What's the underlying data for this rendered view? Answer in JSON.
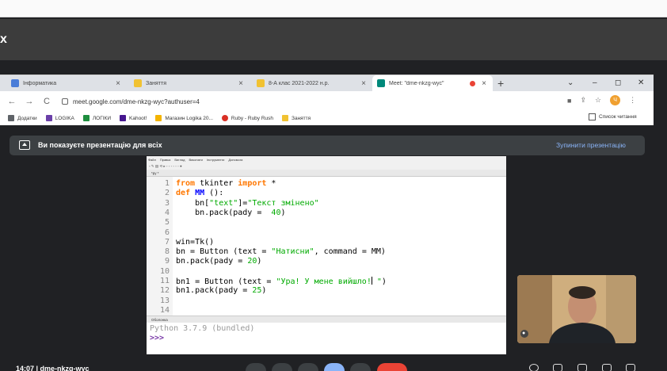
{
  "outer": {
    "close_label": "x"
  },
  "tabs": [
    {
      "title": "Інформатика",
      "color": "#4a7dd8"
    },
    {
      "title": "Заняття",
      "color": "#f1c232"
    },
    {
      "title": "8-А клас 2021-2022 н.р.",
      "color": "#f1c232"
    },
    {
      "title": "Meet: \"dme-nkzg-wyc\"",
      "color": "#00897b"
    }
  ],
  "new_tab": "+",
  "window_controls": [
    "⌄",
    "–",
    "◻",
    "✕"
  ],
  "address": {
    "url": "meet.google.com/dme-nkzg-wyc?authuser=4"
  },
  "nav": {
    "back": "←",
    "forward": "→",
    "reload": "C"
  },
  "profile_initial": "Ч",
  "bookmarks": [
    {
      "label": "Додатки",
      "color": "#5f6368"
    },
    {
      "label": "LOGIKA",
      "color": "#6a3fa8"
    },
    {
      "label": "ЛОГІКИ",
      "color": "#1e8e3e"
    },
    {
      "label": "Kahoot!",
      "color": "#46178f"
    },
    {
      "label": "Магазин Logika 20...",
      "color": "#f4b400"
    },
    {
      "label": "Ruby - Ruby Rush",
      "color": "#d93025"
    },
    {
      "label": "Заняття",
      "color": "#f1c232"
    }
  ],
  "reading_list": "Список читання",
  "banner": {
    "text": "Ви показуєте презентацію для всіх",
    "stop": "Зупинити презентацію"
  },
  "idle": {
    "menu": [
      "Файл",
      "Правка",
      "Вигляд",
      "Виконати",
      "Інструменти",
      "Допомога"
    ],
    "toolbar": "▫ ✎ ▤ ⟲ ▸ ◦ ◦ ◦ ◦ ◦ ◦ ●",
    "editor_tab": "*py *",
    "shell_tab": "Оболонка",
    "shell_version": "Python 3.7.9 (bundled)",
    "shell_prompt": ">>>",
    "code": {
      "lines": [
        {
          "num": "1",
          "parts": [
            [
              "kw",
              "from"
            ],
            [
              "",
              " tkinter "
            ],
            [
              "kw",
              "import"
            ],
            [
              "",
              " *"
            ]
          ]
        },
        {
          "num": "2",
          "parts": [
            [
              "kw",
              "def"
            ],
            [
              "",
              " "
            ],
            [
              "defname",
              "MM"
            ],
            [
              "",
              " ():"
            ]
          ]
        },
        {
          "num": "3",
          "parts": [
            [
              "",
              "    bn["
            ],
            [
              "str",
              "\"text\""
            ],
            [
              "",
              "]="
            ],
            [
              "str",
              "\"Текст змінено\""
            ]
          ]
        },
        {
          "num": "4",
          "parts": [
            [
              "",
              "    bn.pack(pady =  "
            ],
            [
              "str",
              "40"
            ],
            [
              "",
              ")"
            ]
          ]
        },
        {
          "num": "5",
          "parts": []
        },
        {
          "num": "6",
          "parts": []
        },
        {
          "num": "7",
          "parts": [
            [
              "",
              "win=Tk()"
            ]
          ]
        },
        {
          "num": "8",
          "parts": [
            [
              "",
              "bn = Button (text = "
            ],
            [
              "str",
              "\"Натисни\""
            ],
            [
              "",
              ", command = MM)"
            ]
          ]
        },
        {
          "num": "9",
          "parts": [
            [
              "",
              "bn.pack(pady = "
            ],
            [
              "str",
              "20"
            ],
            [
              "",
              ")"
            ]
          ]
        },
        {
          "num": "10",
          "parts": []
        },
        {
          "num": "11",
          "parts": [
            [
              "",
              "bn1 = Button (text = "
            ],
            [
              "str",
              "\"Ура! У мене вийшло!"
            ],
            [
              "caret",
              ""
            ],
            [
              "str",
              " \""
            ],
            [
              "",
              ")"
            ]
          ]
        },
        {
          "num": "12",
          "parts": [
            [
              "",
              "bn1.pack(pady = "
            ],
            [
              "str",
              "25"
            ],
            [
              "",
              ")"
            ]
          ]
        },
        {
          "num": "13",
          "parts": []
        },
        {
          "num": "14",
          "parts": []
        }
      ]
    }
  },
  "bottom": {
    "time_meeting": "14:07  |  dme-nkzg-wyc"
  }
}
